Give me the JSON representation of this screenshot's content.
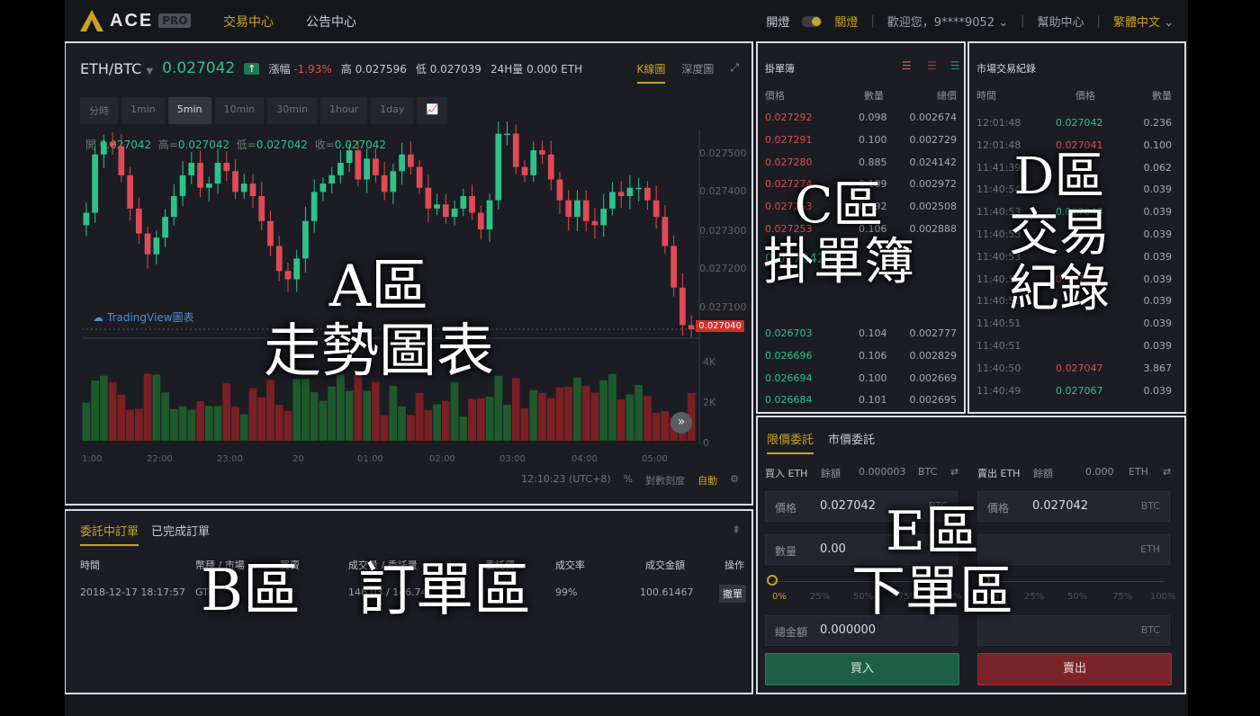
{
  "nav": {
    "logo_text": "ACE",
    "logo_badge": "PRO",
    "links": [
      "交易中心",
      "公告中心"
    ],
    "light_on": "開燈",
    "light_off": "關燈",
    "welcome": "歡迎您，9****9052",
    "help": "幫助中心",
    "language": "繁體中文"
  },
  "chart": {
    "pair": "ETH/BTC",
    "last_price": "0.027042",
    "change_label": "漲幅",
    "change_value": "-1.93%",
    "high_label": "高",
    "high_value": "0.027596",
    "low_label": "低",
    "low_value": "0.027039",
    "vol_label": "24H量",
    "vol_value": "0.000 ETH",
    "tab_kline": "K線圖",
    "tab_depth": "深度圖",
    "intervals": [
      "分時",
      "1min",
      "5min",
      "10min",
      "30min",
      "1hour",
      "1day"
    ],
    "ohlc": {
      "open_label": "開",
      "open": "0.027042",
      "high_label": "高",
      "high": "0.027042",
      "low_label": "低",
      "low": "0.027042",
      "close_label": "收",
      "close": "0.027042"
    },
    "watermark": "TradingView圖表",
    "current_price_tag": "0.027040",
    "footer_time": "12:10:23 (UTC+8)",
    "footer_pct": "%",
    "footer_log": "對數刻度",
    "footer_auto": "自動"
  },
  "chart_data": {
    "type": "candlestick",
    "title": "",
    "y_ticks": [
      "0.027500",
      "0.027400",
      "0.027300",
      "0.027200",
      "0.027100"
    ],
    "volume_ticks": [
      "4K",
      "2K",
      "0"
    ],
    "x_ticks": [
      "1:00",
      "22:00",
      "23:00",
      "20",
      "01:00",
      "02:00",
      "03:00",
      "04:00",
      "05:00"
    ],
    "ylim": [
      0.02704,
      0.02752
    ],
    "close_series": [
      0.02732,
      0.02746,
      0.02749,
      0.02748,
      0.02741,
      0.02733,
      0.02727,
      0.02722,
      0.02726,
      0.02731,
      0.02736,
      0.02741,
      0.02744,
      0.02738,
      0.02739,
      0.02744,
      0.02742,
      0.02737,
      0.02739,
      0.02736,
      0.0273,
      0.02724,
      0.02718,
      0.02716,
      0.02721,
      0.0273,
      0.02737,
      0.02739,
      0.02741,
      0.02744,
      0.02747,
      0.0274,
      0.02745,
      0.02741,
      0.02737,
      0.02742,
      0.02746,
      0.02743,
      0.02738,
      0.02733,
      0.02734,
      0.02731,
      0.02733,
      0.02736,
      0.02732,
      0.02728,
      0.02735,
      0.02751,
      0.02751,
      0.02743,
      0.02741,
      0.02747,
      0.02746,
      0.0274,
      0.02735,
      0.02731,
      0.02735,
      0.0273,
      0.02729,
      0.02733,
      0.02737,
      0.02736,
      0.02738,
      0.02738,
      0.02735,
      0.02731,
      0.02724,
      0.02714,
      0.02705,
      0.02704
    ]
  },
  "orderbook": {
    "title": "掛單簿",
    "headers": [
      "價格",
      "數量",
      "總價"
    ],
    "asks": [
      [
        "0.027292",
        "0.098",
        "0.002674"
      ],
      [
        "0.027291",
        "0.100",
        "0.002729"
      ],
      [
        "0.027280",
        "0.885",
        "0.024142"
      ],
      [
        "0.027274",
        "0.109",
        "0.002972"
      ],
      [
        "0.027263",
        "0.092",
        "0.002508"
      ],
      [
        "0.027253",
        "0.106",
        "0.002888"
      ]
    ],
    "mid_price": "0.027042",
    "bids": [
      [
        "0.026703",
        "0.104",
        "0.002777"
      ],
      [
        "0.026696",
        "0.106",
        "0.002829"
      ],
      [
        "0.026694",
        "0.100",
        "0.002669"
      ],
      [
        "0.026684",
        "0.101",
        "0.002695"
      ]
    ]
  },
  "trades": {
    "title": "市場交易紀錄",
    "headers": [
      "時間",
      "價格",
      "數量"
    ],
    "rows": [
      [
        "12:01:48",
        "0.027042",
        "0.236",
        "green"
      ],
      [
        "12:01:48",
        "0.027041",
        "0.100",
        "red"
      ],
      [
        "11:41:39",
        "",
        "0.062",
        "red"
      ],
      [
        "11:40:54",
        "",
        "0.039",
        "green"
      ],
      [
        "11:40:53",
        "0.027043",
        "0.039",
        "green"
      ],
      [
        "11:40:53",
        "",
        "0.039",
        "green"
      ],
      [
        "11:40:53",
        "",
        "0.039",
        "green"
      ],
      [
        "11:40:52",
        "0.027045",
        "0.039",
        "red"
      ],
      [
        "11:40:51",
        "",
        "0.039",
        "green"
      ],
      [
        "11:40:51",
        "",
        "0.039",
        "green"
      ],
      [
        "11:40:51",
        "",
        "0.039",
        "green"
      ],
      [
        "11:40:50",
        "0.027047",
        "3.867",
        "red"
      ],
      [
        "11:40:49",
        "0.027067",
        "0.039",
        "green"
      ]
    ]
  },
  "orders": {
    "tab_open": "委託中訂單",
    "tab_done": "已完成訂單",
    "headers": [
      "時間",
      "幣種 / 市場",
      "買賣",
      "成交量 / 委託量",
      "委託價",
      "成交率",
      "成交金額",
      "操作"
    ],
    "row": {
      "time": "2018-12-17 18:17:57",
      "market": "GTC",
      "side": "",
      "volume": "146.03 / 146.74",
      "price": "",
      "rate": "99%",
      "amount": "100.61467",
      "action": "撤單"
    }
  },
  "trade_form": {
    "tab_limit": "限價委託",
    "tab_market": "市價委託",
    "buy_title": "買入 ETH",
    "sell_title": "賣出 ETH",
    "balance_label": "餘額",
    "buy_balance": "0.000003",
    "buy_balance_unit": "BTC",
    "sell_balance": "0.000",
    "sell_balance_unit": "ETH",
    "price_label": "價格",
    "qty_label": "數量",
    "total_label": "總金額",
    "buy_price": "0.027042",
    "sell_price": "0.027042",
    "buy_qty": "0.00",
    "buy_total": "0.000000",
    "unit_btc": "BTC",
    "unit_eth": "ETH",
    "pct_marks": [
      "0%",
      "25%",
      "50%",
      "75%",
      "100%"
    ],
    "buy_btn": "買入",
    "sell_btn": "賣出"
  },
  "overlays": {
    "a": "A區",
    "a_sub": "走勢圖表",
    "b": "B區　訂單區",
    "c": "C區",
    "c_sub": "掛單簿",
    "d": "D區",
    "d_sub1": "交易",
    "d_sub2": "紀錄",
    "e": "E區",
    "e_sub": "下單區"
  },
  "colors": {
    "accent": "#c9a227",
    "up": "#2ec28b",
    "down": "#e04a55",
    "frame": "#d9dde2"
  }
}
